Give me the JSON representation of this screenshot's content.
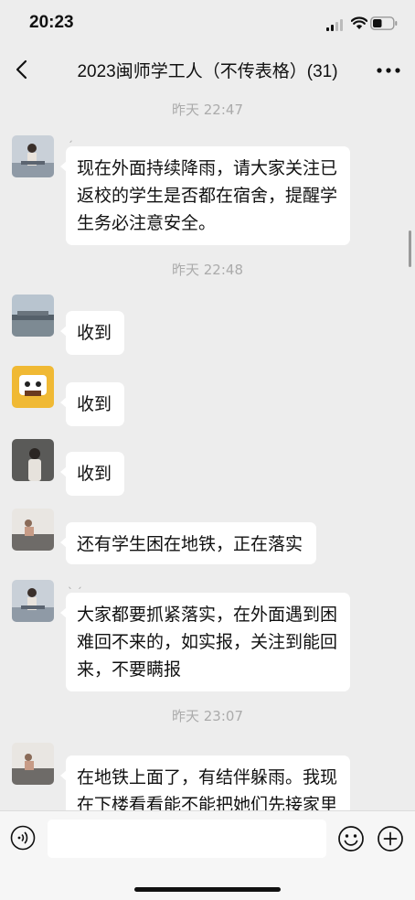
{
  "status_bar": {
    "time": "20:23"
  },
  "header": {
    "title": "2023闽师学工人（不传表格）(31)"
  },
  "messages": [
    {
      "type": "timestamp",
      "text": "昨天 22:47"
    },
    {
      "type": "message",
      "text": "现在外面持续降雨，请大家关注已返校的学生是否都在宿舍，提醒学生务必注意安全。",
      "line1": "现在外面持续降雨，请大家关注已",
      "line2": "返校的学生是否都在宿舍，提醒学",
      "line3": "生务必注意安全。"
    },
    {
      "type": "timestamp",
      "text": "昨天 22:48"
    },
    {
      "type": "message",
      "text": "收到"
    },
    {
      "type": "message",
      "text": "收到"
    },
    {
      "type": "message",
      "text": "收到"
    },
    {
      "type": "message",
      "text": "还有学生困在地铁，正在落实"
    },
    {
      "type": "message",
      "line1": "大家都要抓紧落实，在外面遇到困",
      "line2": "难回不来的，如实报，关注到能回",
      "line3": "来，不要瞒报"
    },
    {
      "type": "timestamp",
      "text": "昨天 23:07"
    },
    {
      "type": "message",
      "line1": "在地铁上面了，有结伴躲雨。我现",
      "line2": "在下楼看看能不能把她们先接家里"
    }
  ],
  "icons": {
    "back": "chevron-left-icon",
    "more": "ellipsis-icon",
    "voice": "voice-input-icon",
    "emoji": "emoji-icon",
    "plus": "plus-icon"
  }
}
